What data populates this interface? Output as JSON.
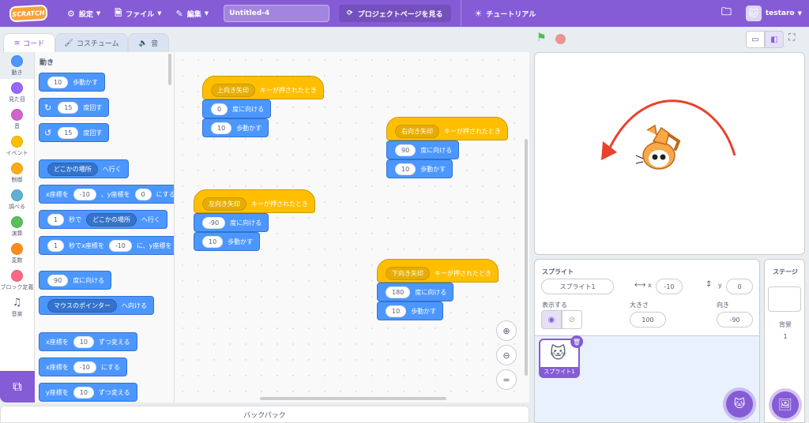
{
  "menubar": {
    "logo": "SCRATCH",
    "settings": "設定",
    "file": "ファイル",
    "edit": "編集",
    "project_title": "Untitled-4",
    "project_page": "プロジェクトページを見る",
    "tutorials": "チュートリアル",
    "username": "testaro"
  },
  "tabs": {
    "code": "コード",
    "costumes": "コスチューム",
    "sounds": "音"
  },
  "categories": [
    {
      "label": "動き",
      "color": "#4c97ff"
    },
    {
      "label": "見た目",
      "color": "#9966ff"
    },
    {
      "label": "音",
      "color": "#cf63cf"
    },
    {
      "label": "イベント",
      "color": "#ffbf00"
    },
    {
      "label": "制御",
      "color": "#ffab19"
    },
    {
      "label": "調べる",
      "color": "#5cb1d6"
    },
    {
      "label": "演算",
      "color": "#59c059"
    },
    {
      "label": "変数",
      "color": "#ff8c1a"
    },
    {
      "label": "ブロック定義",
      "color": "#ff6680"
    },
    {
      "label": "音楽",
      "color": ""
    }
  ],
  "palette": {
    "title": "動き",
    "move_val": "10",
    "move_txt": "歩動かす",
    "turn_r_val": "15",
    "turn_r_txt": "度回す",
    "turn_l_val": "15",
    "turn_l_txt": "度回す",
    "goto_dd": "どこかの場所",
    "goto_txt": "へ行く",
    "gotoxy_x_lbl": "x座標を",
    "gotoxy_x": "-10",
    "gotoxy_sep": "、y座標を",
    "gotoxy_y": "0",
    "gotoxy_end": "にする",
    "glide_val": "1",
    "glide_txt": "秒で",
    "glide_dd": "どこかの場所",
    "glide_end": "へ行く",
    "glidexy_val": "1",
    "glidexy_txt": "秒でx座標を",
    "glidexy_x": "-10",
    "glidexy_mid": "に、y座標を",
    "point_val": "90",
    "point_txt": "度に向ける",
    "towards_dd": "マウスのポインター",
    "towards_txt": "へ向ける",
    "chx_lbl": "x座標を",
    "chx_val": "10",
    "chx_txt": "ずつ変える",
    "setx_lbl": "x座標を",
    "setx_val": "-10",
    "setx_txt": "にする",
    "chy_lbl": "y座標を",
    "chy_val": "10",
    "chy_txt": "ずつ変える"
  },
  "scripts": [
    {
      "key": "上向き矢印",
      "hat": "キーが押されたとき",
      "dir": "0",
      "dir_txt": "度に向ける",
      "steps": "10",
      "steps_txt": "歩動かす"
    },
    {
      "key": "右向き矢印",
      "hat": "キーが押されたとき",
      "dir": "90",
      "dir_txt": "度に向ける",
      "steps": "10",
      "steps_txt": "歩動かす"
    },
    {
      "key": "左向き矢印",
      "hat": "キーが押されたとき",
      "dir": "-90",
      "dir_txt": "度に向ける",
      "steps": "10",
      "steps_txt": "歩動かす"
    },
    {
      "key": "下向き矢印",
      "hat": "キーが押されたとき",
      "dir": "180",
      "dir_txt": "度に向ける",
      "steps": "10",
      "steps_txt": "歩動かす"
    }
  ],
  "backpack": "バックパック",
  "sprite_info": {
    "label": "スプライト",
    "name": "スプライト1",
    "x_lbl": "x",
    "x": "-10",
    "y_lbl": "y",
    "y": "0",
    "show_lbl": "表示する",
    "size_lbl": "大きさ",
    "size": "100",
    "dir_lbl": "向き",
    "dir": "-90"
  },
  "sprite_list": [
    {
      "name": "スプライト1"
    }
  ],
  "stage_pane": {
    "title": "ステージ",
    "backdrop_lbl": "背景",
    "backdrop_count": "1"
  },
  "colors": {
    "accent": "#855cd6",
    "motion": "#4c97ff",
    "events": "#ffbf00",
    "arrow": "#e8412c"
  }
}
